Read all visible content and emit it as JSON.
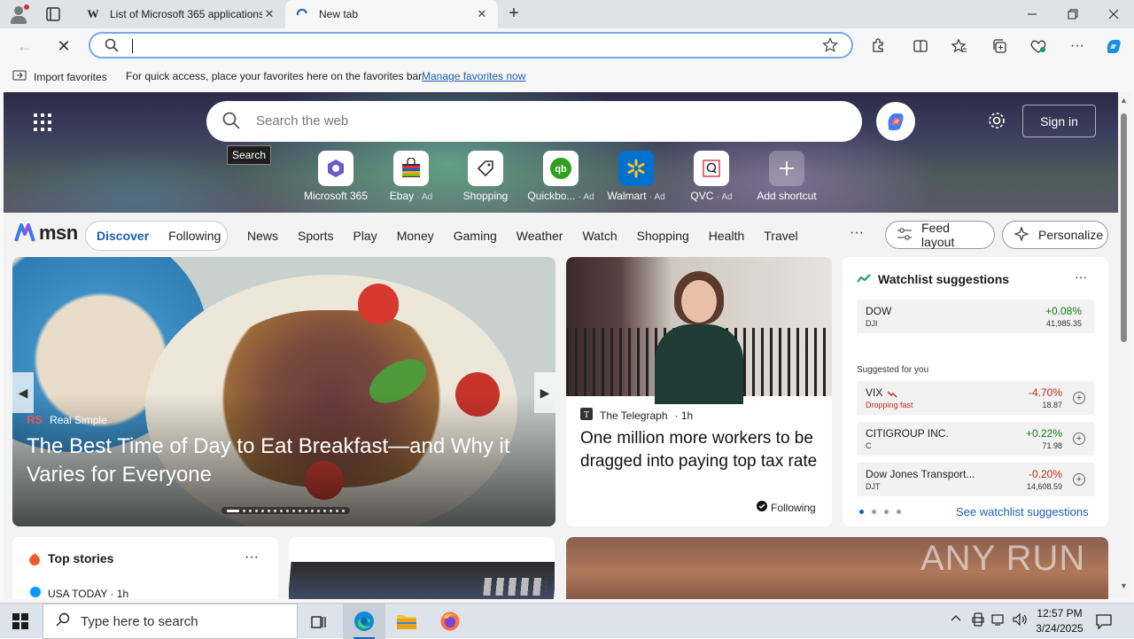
{
  "browser": {
    "tabs": [
      {
        "title": "List of Microsoft 365 applications",
        "favicon": "W"
      },
      {
        "title": "New tab"
      }
    ],
    "address": {
      "value": "",
      "placeholder": ""
    },
    "favbar": {
      "import_label": "Import favorites",
      "message": "For quick access, place your favorites here on the favorites bar.",
      "manage_link": "Manage favorites now"
    }
  },
  "newtab": {
    "search_placeholder": "Search the web",
    "tooltip": "Search",
    "signin": "Sign in",
    "shortcuts": [
      {
        "label": "Microsoft 365",
        "ad": ""
      },
      {
        "label": "Ebay",
        "ad": "· Ad"
      },
      {
        "label": "Shopping",
        "ad": ""
      },
      {
        "label": "Quickbo...",
        "ad": "· Ad"
      },
      {
        "label": "Walmart",
        "ad": "· Ad"
      },
      {
        "label": "QVC",
        "ad": "· Ad"
      },
      {
        "label": "Add shortcut",
        "ad": ""
      }
    ]
  },
  "msn": {
    "logo": "msn",
    "pill": {
      "discover": "Discover",
      "following": "Following"
    },
    "nav": [
      "News",
      "Sports",
      "Play",
      "Money",
      "Gaming",
      "Weather",
      "Watch",
      "Shopping",
      "Health",
      "Travel"
    ],
    "more": "···",
    "feed_layout": "Feed layout",
    "personalize": "Personalize"
  },
  "hero_story": {
    "source_logo": "RS",
    "source": "Real Simple",
    "headline": "The Best Time of Day to Eat Breakfast—and Why it Varies for Everyone"
  },
  "story2": {
    "source": "The Telegraph",
    "time": "· 1h",
    "headline": "One million more workers to be dragged into paying top tax rate",
    "following": "Following"
  },
  "watchlist": {
    "title": "Watchlist suggestions",
    "more": "···",
    "main": {
      "name": "DOW",
      "ticker": "DJI",
      "change": "+0.08%",
      "price": "41,985.35"
    },
    "suggested_label": "Suggested for you",
    "rows": [
      {
        "name": "VIX",
        "ticker": "Dropping fast",
        "change": "-4.70%",
        "price": "18.87",
        "color": "#c42b1c"
      },
      {
        "name": "CITIGROUP INC.",
        "ticker": "C",
        "change": "+0.22%",
        "price": "71.98",
        "color": "#0f7b0f"
      },
      {
        "name": "Dow Jones Transport...",
        "ticker": "DJT",
        "change": "-0.20%",
        "price": "14,608.59",
        "color": "#c42b1c"
      }
    ],
    "see_more": "See watchlist suggestions"
  },
  "top_stories": {
    "title": "Top stories",
    "more": "···",
    "source": "USA TODAY · 1h"
  },
  "watermark": "ANY RUN",
  "taskbar": {
    "search_placeholder": "Type here to search",
    "time": "12:57 PM",
    "date": "3/24/2025"
  },
  "colors": {
    "accent": "#1a5fb4",
    "positive": "#0f7b0f",
    "negative": "#c42b1c"
  }
}
